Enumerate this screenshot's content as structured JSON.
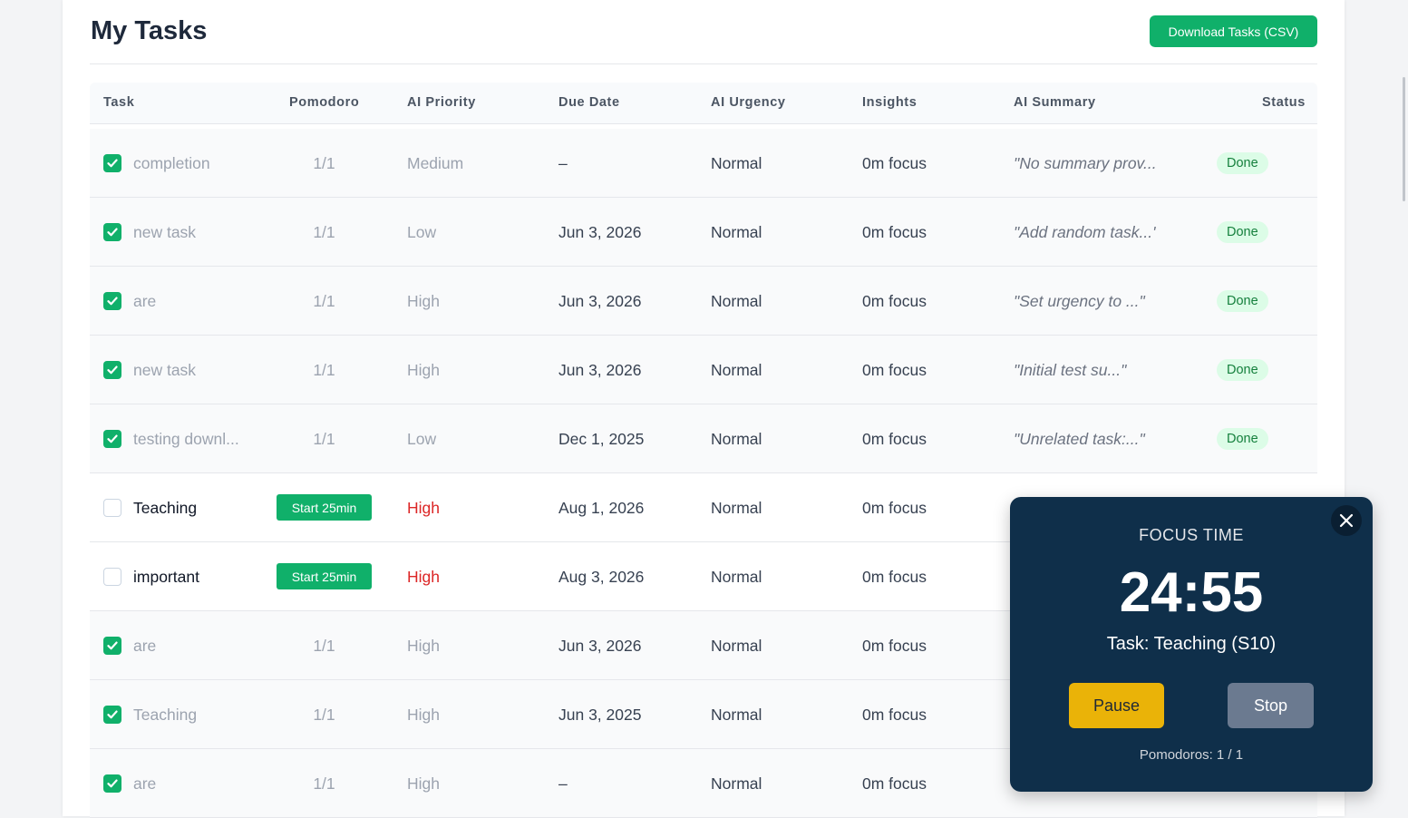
{
  "page": {
    "title": "My Tasks",
    "download_label": "Download Tasks (CSV)"
  },
  "table": {
    "columns": [
      "Task",
      "Pomodoro",
      "AI Priority",
      "Due Date",
      "AI Urgency",
      "Insights",
      "AI Summary",
      "Status"
    ],
    "rows": [
      {
        "completed": true,
        "name": "completion",
        "pomodoro": "1/1",
        "priority": "Medium",
        "due": "–",
        "urgency": "Normal",
        "insights": "0m focus",
        "summary": "\"No summary prov...",
        "status": "Done"
      },
      {
        "completed": true,
        "name": "new task",
        "pomodoro": "1/1",
        "priority": "Low",
        "due": "Jun 3, 2026",
        "urgency": "Normal",
        "insights": "0m focus",
        "summary": "\"Add random task...'",
        "status": "Done"
      },
      {
        "completed": true,
        "name": "are",
        "pomodoro": "1/1",
        "priority": "High",
        "due": "Jun 3, 2026",
        "urgency": "Normal",
        "insights": "0m focus",
        "summary": "\"Set urgency to ...\"",
        "status": "Done"
      },
      {
        "completed": true,
        "name": "new task",
        "pomodoro": "1/1",
        "priority": "High",
        "due": "Jun 3, 2026",
        "urgency": "Normal",
        "insights": "0m focus",
        "summary": "\"Initial test su...\"",
        "status": "Done"
      },
      {
        "completed": true,
        "name": "testing downl...",
        "pomodoro": "1/1",
        "priority": "Low",
        "due": "Dec 1, 2025",
        "urgency": "Normal",
        "insights": "0m focus",
        "summary": "\"Unrelated task:...\"",
        "status": "Done"
      },
      {
        "completed": false,
        "name": "Teaching",
        "pomodoro": "Start 25min",
        "priority": "High",
        "due": "Aug 1, 2026",
        "urgency": "Normal",
        "insights": "0m focus",
        "summary": "",
        "status": ""
      },
      {
        "completed": false,
        "name": "important",
        "pomodoro": "Start 25min",
        "priority": "High",
        "due": "Aug 3, 2026",
        "urgency": "Normal",
        "insights": "0m focus",
        "summary": "",
        "status": ""
      },
      {
        "completed": true,
        "name": "are",
        "pomodoro": "1/1",
        "priority": "High",
        "due": "Jun 3, 2026",
        "urgency": "Normal",
        "insights": "0m focus",
        "summary": "",
        "status": ""
      },
      {
        "completed": true,
        "name": "Teaching",
        "pomodoro": "1/1",
        "priority": "High",
        "due": "Jun 3, 2025",
        "urgency": "Normal",
        "insights": "0m focus",
        "summary": "",
        "status": ""
      },
      {
        "completed": true,
        "name": "are",
        "pomodoro": "1/1",
        "priority": "High",
        "due": "–",
        "urgency": "Normal",
        "insights": "0m focus",
        "summary": "",
        "status": ""
      }
    ]
  },
  "focus": {
    "label": "FOCUS TIME",
    "timer": "24:55",
    "task": "Task: Teaching (S10)",
    "pause_label": "Pause",
    "stop_label": "Stop",
    "pomodoros": "Pomodoros: 1 / 1"
  },
  "colors": {
    "accent_green": "#10b06a",
    "panel_bg": "#0f2f4a",
    "pause_yellow": "#eab308",
    "high_red": "#dc2626"
  }
}
